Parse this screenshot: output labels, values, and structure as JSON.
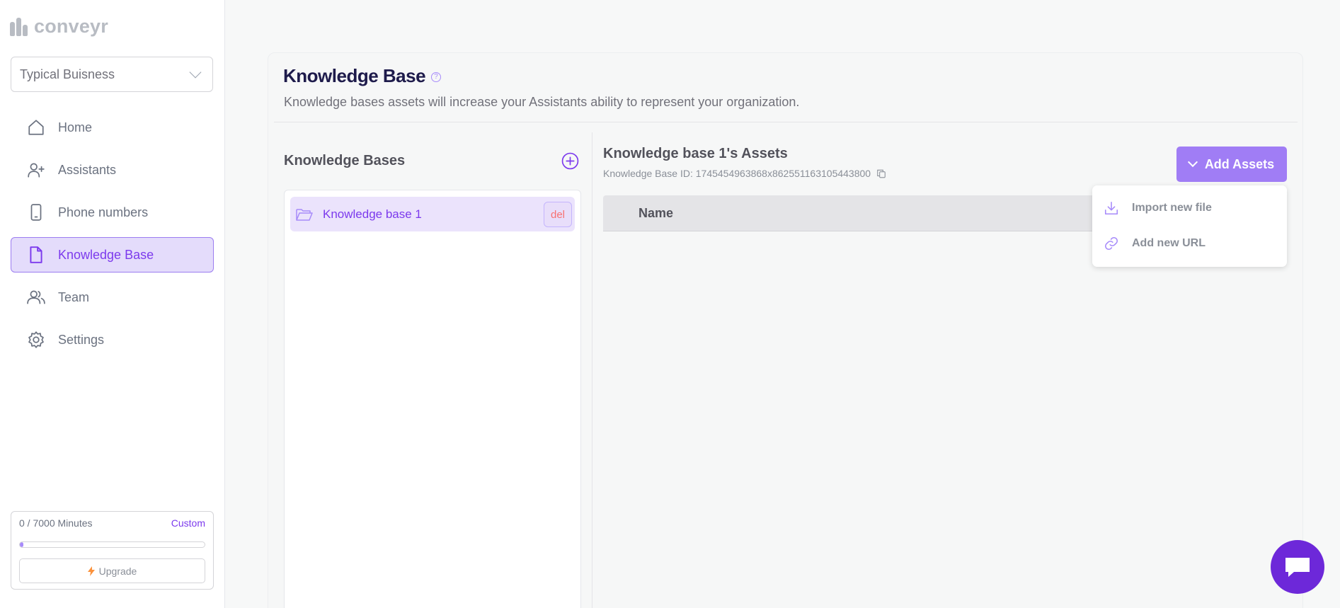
{
  "app": {
    "logo_text": "conveyr"
  },
  "org_select": {
    "value": "Typical Buisness"
  },
  "nav": {
    "items": [
      {
        "label": "Home",
        "icon": "home-icon"
      },
      {
        "label": "Assistants",
        "icon": "user-plus-icon"
      },
      {
        "label": "Phone numbers",
        "icon": "phone-icon"
      },
      {
        "label": "Knowledge Base",
        "icon": "file-icon",
        "active": true
      },
      {
        "label": "Team",
        "icon": "team-icon"
      },
      {
        "label": "Settings",
        "icon": "gear-icon"
      }
    ]
  },
  "usage": {
    "minutes_label": "0 / 7000 Minutes",
    "plan": "Custom",
    "progress_fraction": 0.02,
    "upgrade_label": "Upgrade"
  },
  "page": {
    "title": "Knowledge Base",
    "subtitle": "Knowledge bases assets will increase your Assistants ability to represent your organization."
  },
  "kb_panel": {
    "title": "Knowledge Bases",
    "items": [
      {
        "name": "Knowledge base 1",
        "delete_label": "del"
      }
    ]
  },
  "assets_panel": {
    "title": "Knowledge base 1's Assets",
    "id_label": "Knowledge Base ID: 1745454963868x862551163105443800",
    "add_button": "Add Assets",
    "table_header": "Name",
    "menu": [
      {
        "label": "Import new file",
        "icon": "download-icon"
      },
      {
        "label": "Add new URL",
        "icon": "link-icon"
      }
    ]
  },
  "colors": {
    "accent": "#7c3aed",
    "accent_light": "#a07df5",
    "danger": "#f87171"
  }
}
